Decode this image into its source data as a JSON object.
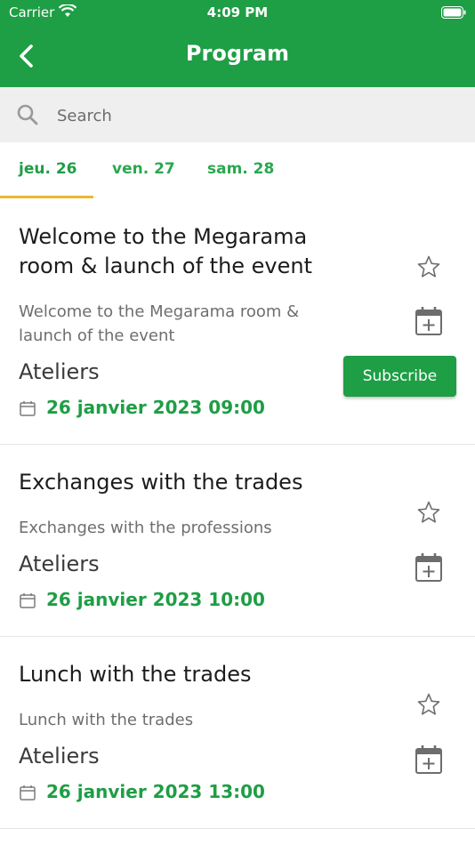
{
  "status_bar": {
    "carrier": "Carrier",
    "time": "4:09 PM"
  },
  "nav": {
    "title": "Program"
  },
  "search": {
    "placeholder": "Search"
  },
  "tabs": [
    {
      "label": "jeu. 26",
      "active": true
    },
    {
      "label": "ven. 27",
      "active": false
    },
    {
      "label": "sam. 28",
      "active": false
    }
  ],
  "events": [
    {
      "title_line1": "Welcome to the Megarama",
      "title_line2": "room & launch of the event",
      "desc_line1": "Welcome to the Megarama room &",
      "desc_line2": "launch of the event",
      "category": "Ateliers",
      "date": "26 janvier 2023 09:00",
      "subscribe_label": "Subscribe"
    },
    {
      "title_line1": "Exchanges with the trades",
      "desc_line1": "Exchanges with the professions",
      "category": "Ateliers",
      "date": "26 janvier 2023 10:00"
    },
    {
      "title_line1": "Lunch with the trades",
      "desc_line1": "Lunch with the trades",
      "category": "Ateliers",
      "date": "26 janvier 2023 13:00"
    }
  ],
  "colors": {
    "brand_green": "#1e9e45",
    "tab_indicator": "#e9b833"
  },
  "icons": [
    "back-icon",
    "search-icon",
    "star-icon",
    "calendar-add-icon",
    "calendar-icon",
    "wifi-icon",
    "battery-icon"
  ]
}
